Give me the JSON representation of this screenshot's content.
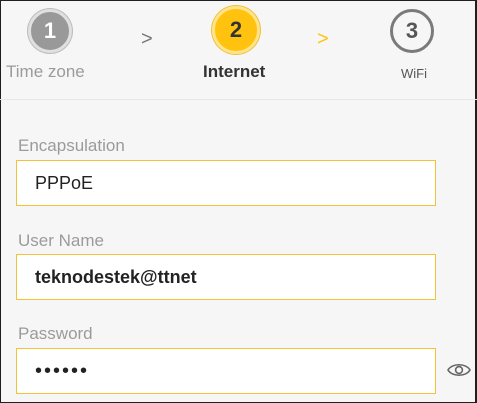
{
  "wizard": {
    "steps": [
      {
        "number": "1",
        "label": "Time zone"
      },
      {
        "number": "2",
        "label": "Internet"
      },
      {
        "number": "3",
        "label": "WiFi"
      }
    ],
    "separator": ">",
    "active_color": "#ffc20e"
  },
  "form": {
    "encapsulation": {
      "label": "Encapsulation",
      "value": "PPPoE"
    },
    "username": {
      "label": "User Name",
      "value": "teknodestek@ttnet"
    },
    "password": {
      "label": "Password",
      "value": "••••••",
      "toggle_icon": "eye-icon"
    }
  }
}
